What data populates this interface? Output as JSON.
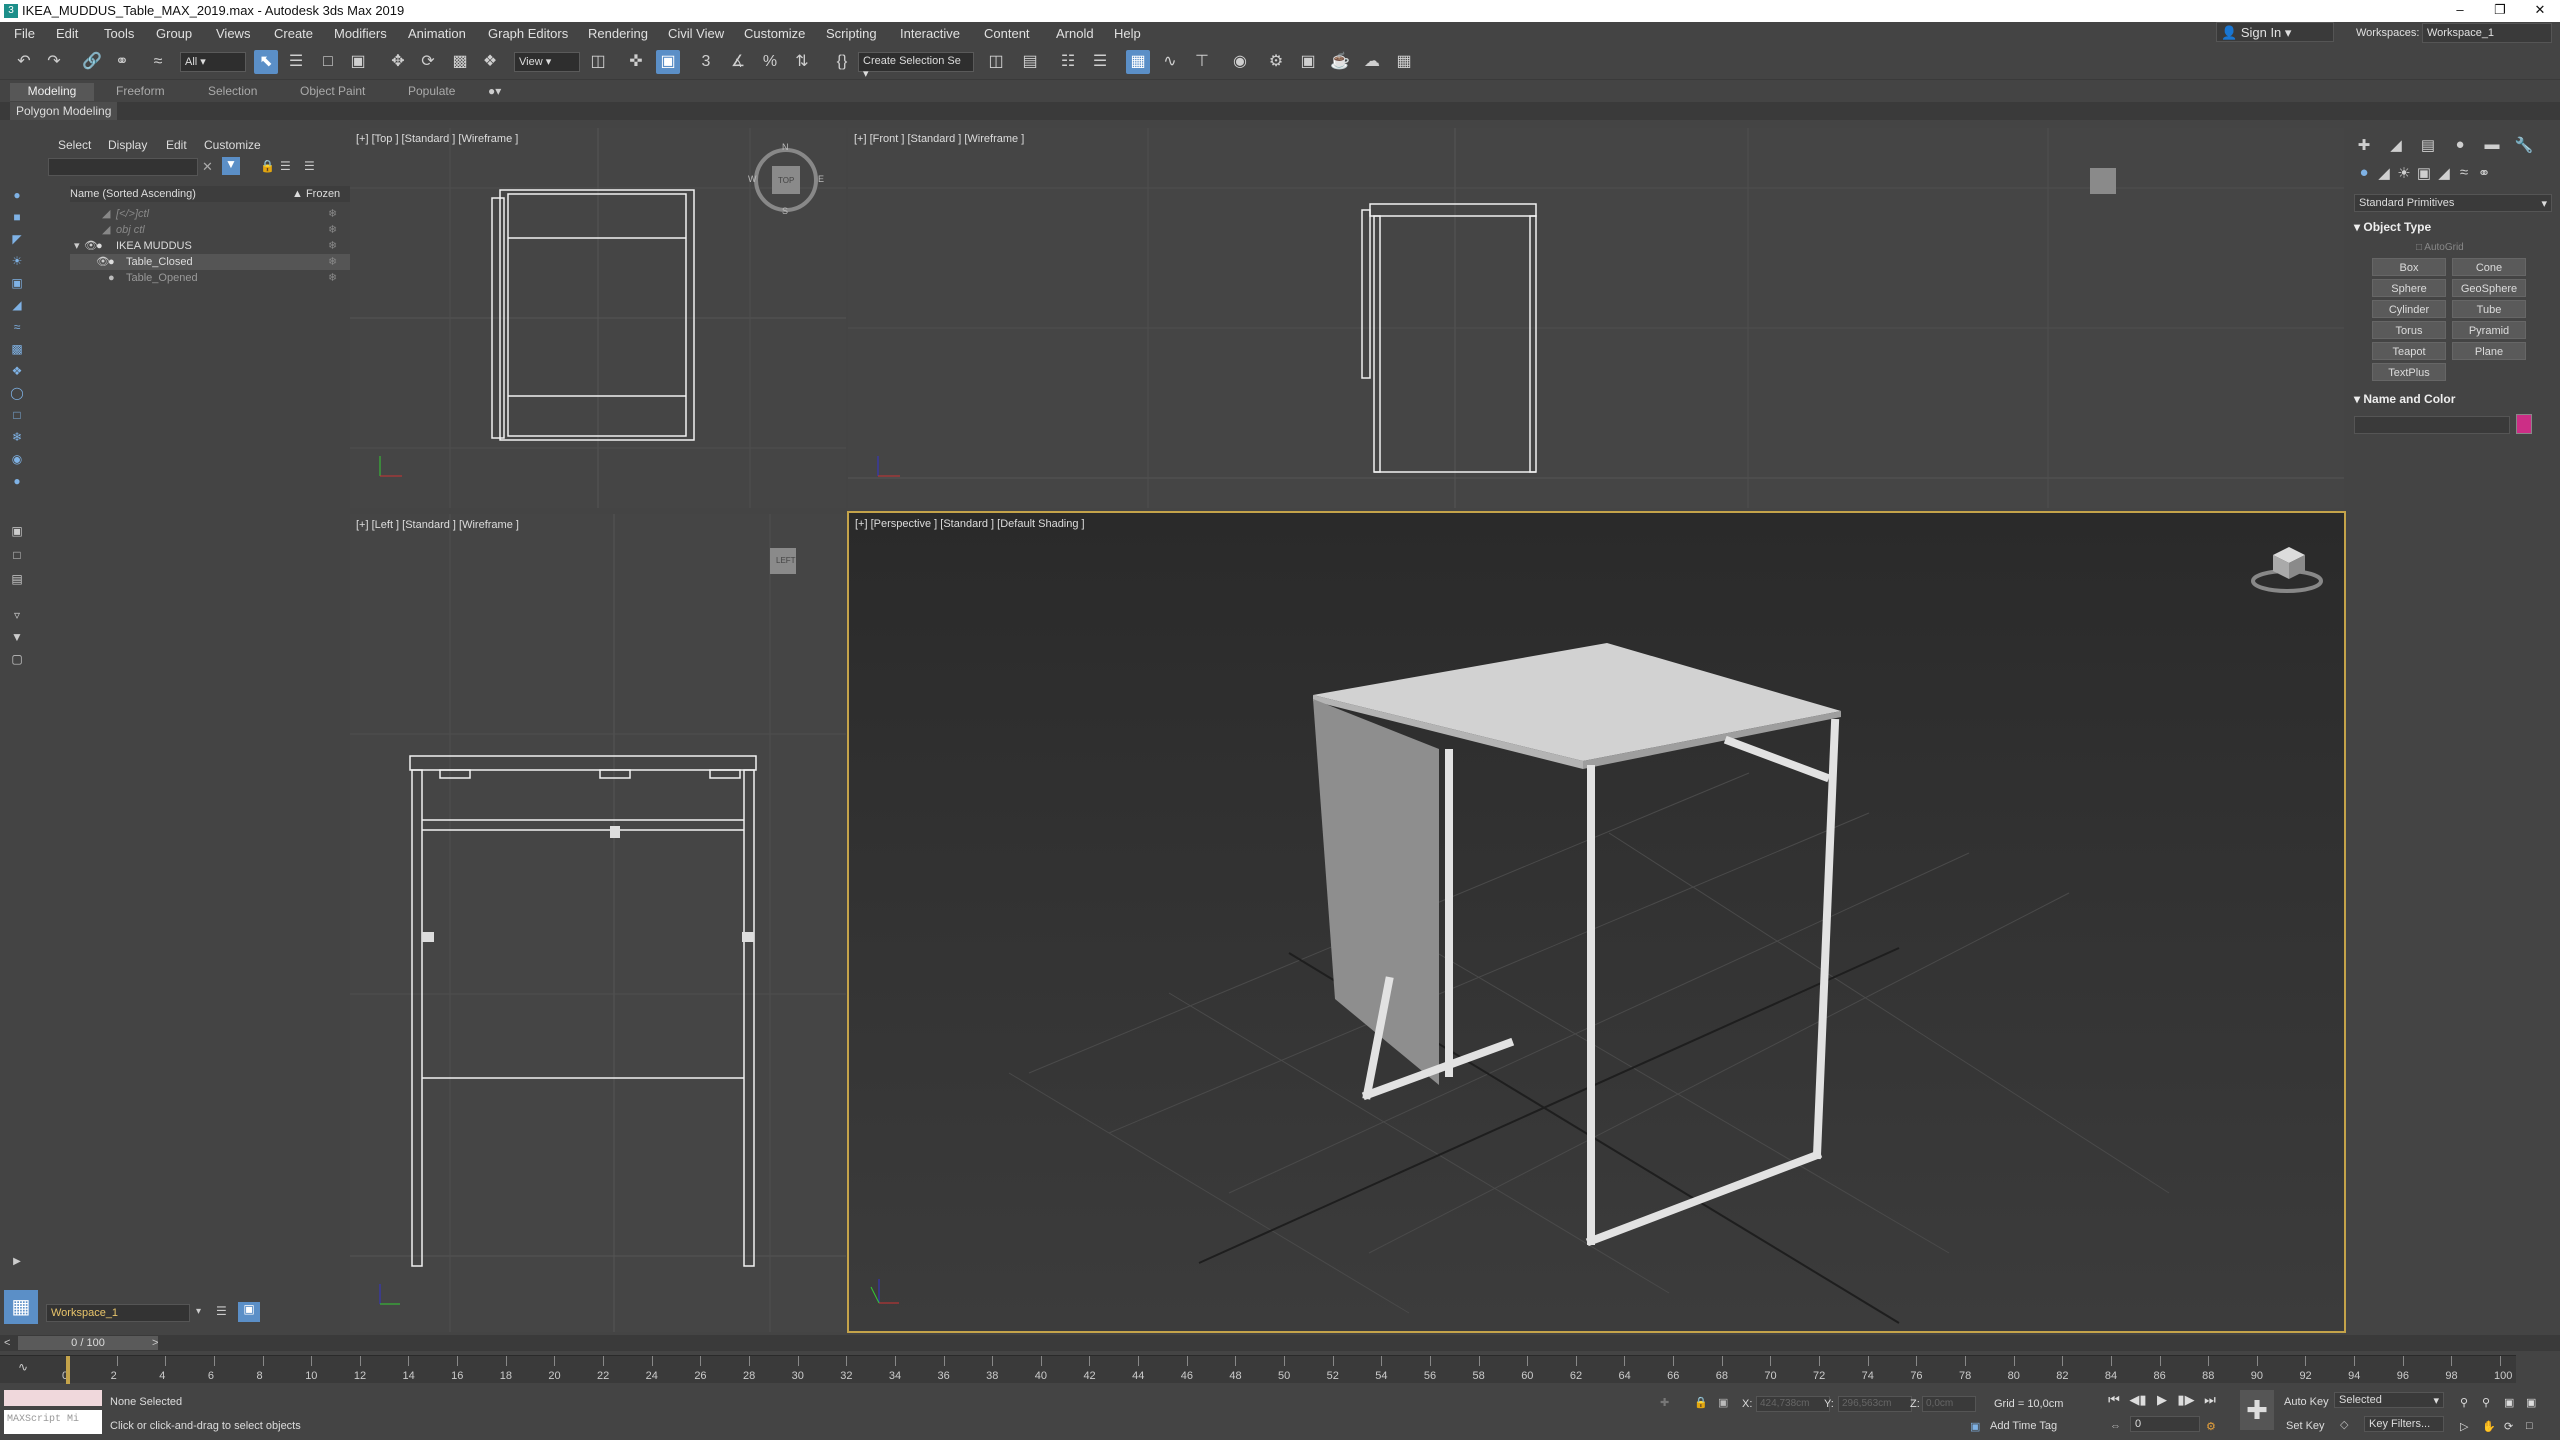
{
  "window": {
    "title": "IKEA_MUDDUS_Table_MAX_2019.max - Autodesk 3ds Max 2019"
  },
  "menu": [
    "File",
    "Edit",
    "Tools",
    "Group",
    "Views",
    "Create",
    "Modifiers",
    "Animation",
    "Graph Editors",
    "Rendering",
    "Civil View",
    "Customize",
    "Scripting",
    "Interactive",
    "Content",
    "Arnold",
    "Help"
  ],
  "account": {
    "sign_in": "Sign In",
    "workspaces_label": "Workspaces:",
    "workspace": "Workspace_1"
  },
  "toolbar": {
    "filter": "All",
    "refcoord": "View",
    "selection_set": "Create Selection Se"
  },
  "ribbon": {
    "tabs": [
      "Modeling",
      "Freeform",
      "Selection",
      "Object Paint",
      "Populate"
    ],
    "sub": "Polygon Modeling"
  },
  "scene_explorer": {
    "menu": [
      "Select",
      "Display",
      "Edit",
      "Customize"
    ],
    "col_name": "Name (Sorted Ascending)",
    "col_frozen": "▲ Frozen",
    "rows": [
      "[</>]ctl",
      "obj ctl",
      "IKEA MUDDUS",
      "Table_Closed",
      "Table_Opened"
    ]
  },
  "viewports": {
    "top": "[+] [Top ] [Standard ] [Wireframe ]",
    "front": "[+] [Front ] [Standard ] [Wireframe ]",
    "left": "[+] [Left ] [Standard ] [Wireframe ]",
    "perspective": "[+] [Perspective ] [Standard ] [Default Shading ]",
    "compass": {
      "n": "N",
      "s": "S",
      "w": "W",
      "e": "E",
      "top": "TOP",
      "left": "LEFT"
    }
  },
  "command_panel": {
    "category": "Standard Primitives",
    "object_type": "Object Type",
    "autogrid": "AutoGrid",
    "buttons": [
      "Box",
      "Cone",
      "Sphere",
      "GeoSphere",
      "Cylinder",
      "Tube",
      "Torus",
      "Pyramid",
      "Teapot",
      "Plane",
      "TextPlus"
    ],
    "name_color": "Name and Color",
    "color": "#cc2e86"
  },
  "workspace_bar": {
    "workspace": "Workspace_1"
  },
  "timeline": {
    "frame": "0 / 100",
    "ticks": [
      "0",
      "2",
      "4",
      "6",
      "8",
      "10",
      "12",
      "14",
      "16",
      "18",
      "20",
      "22",
      "24",
      "26",
      "28",
      "30",
      "32",
      "34",
      "36",
      "38",
      "40",
      "42",
      "44",
      "46",
      "48",
      "50",
      "52",
      "54",
      "56",
      "58",
      "60",
      "62",
      "64",
      "66",
      "68",
      "70",
      "72",
      "74",
      "76",
      "78",
      "80",
      "82",
      "84",
      "86",
      "88",
      "90",
      "92",
      "94",
      "96",
      "98",
      "100"
    ]
  },
  "status": {
    "maxscript": "MAXScript Mi",
    "selection": "None Selected",
    "prompt": "Click or click-and-drag to select objects",
    "x_label": "X:",
    "x_value": "424,738cm",
    "y_label": "Y:",
    "y_value": "296,563cm",
    "z_label": "Z:",
    "z_value": "0,0cm",
    "grid": "Grid = 10,0cm",
    "add_time_tag": "Add Time Tag",
    "auto_key": "Auto Key",
    "set_key": "Set Key",
    "key_mode": "Selected",
    "key_filters": "Key Filters...",
    "frame_field": "0"
  }
}
